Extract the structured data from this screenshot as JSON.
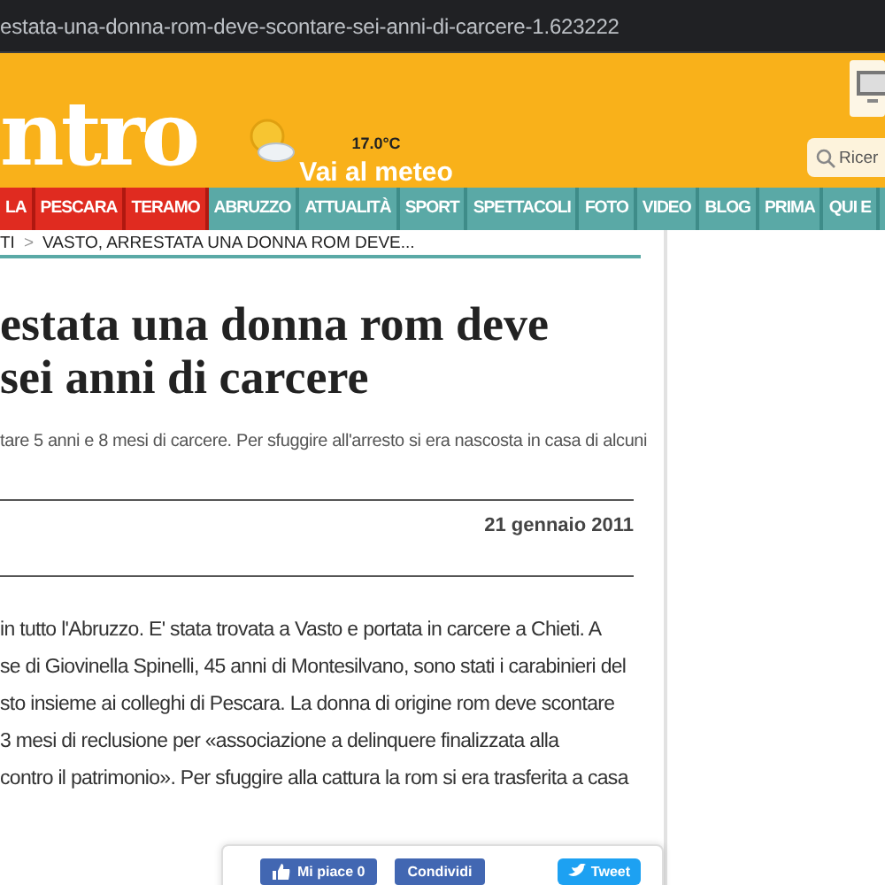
{
  "browser": {
    "url": "estata-una-donna-rom-deve-scontare-sei-anni-di-carcere-1.623222"
  },
  "header": {
    "logo": "ntro",
    "weather": {
      "temperature": "17.0°C",
      "link": "Vai al meteo"
    },
    "search": {
      "placeholder": "Ricer"
    }
  },
  "nav": [
    {
      "label": "LA",
      "kind": "city"
    },
    {
      "label": "PESCARA",
      "kind": "city"
    },
    {
      "label": "TERAMO",
      "kind": "city"
    },
    {
      "label": "ABRUZZO",
      "kind": "section"
    },
    {
      "label": "ATTUALITÀ",
      "kind": "section"
    },
    {
      "label": "SPORT",
      "kind": "section"
    },
    {
      "label": "SPETTACOLI",
      "kind": "section"
    },
    {
      "label": "FOTO",
      "kind": "section"
    },
    {
      "label": "VIDEO",
      "kind": "section"
    },
    {
      "label": "BLOG",
      "kind": "section"
    },
    {
      "label": "PRIMA",
      "kind": "section"
    },
    {
      "label": "QUI E",
      "kind": "section"
    }
  ],
  "breadcrumb": [
    "TI",
    "VASTO, ARRESTATA UNA DONNA ROM DEVE..."
  ],
  "breadcrumb_separator": ">",
  "article": {
    "title_lines": [
      "estata una donna rom deve",
      "sei anni di carcere"
    ],
    "summary": "tare 5 anni e 8 mesi di carcere. Per sfuggire all'arresto si era nascosta in casa di alcuni",
    "date": "21 gennaio 2011",
    "body_lines": [
      "in tutto l'Abruzzo. E' stata trovata a Vasto e portata in carcere a Chieti. A",
      "se di Giovinella Spinelli, 45 anni di Montesilvano, sono stati i carabinieri del",
      "sto insieme ai colleghi di Pescara. La donna di origine rom deve scontare",
      "3 mesi di reclusione per «associazione a delinquere finalizzata alla",
      "contro il patrimonio». Per sfuggire alla cattura la rom si era trasferita a casa"
    ]
  },
  "share": {
    "like": "Mi piace 0",
    "share": "Condividi",
    "tweet": "Tweet"
  }
}
